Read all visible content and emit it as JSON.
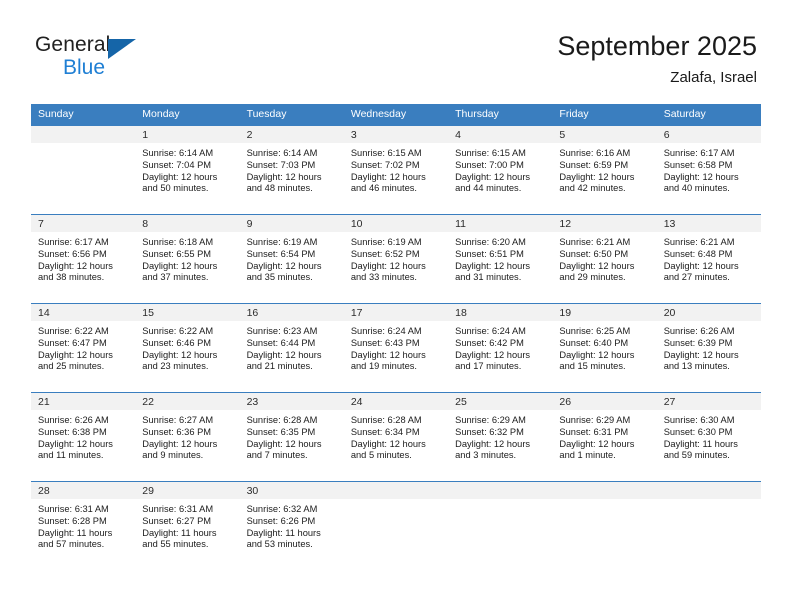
{
  "brand": {
    "name_top": "General",
    "name_bottom": "Blue",
    "accent_color": "#1f7fd4",
    "triangle_color": "#1565a8"
  },
  "header": {
    "title": "September 2025",
    "subtitle": "Zalafa, Israel"
  },
  "theme": {
    "header_row_bg": "#3a7ebf",
    "daynum_bg": "#f2f2f2",
    "grid_line": "#3a7ebf",
    "text": "#1c1c1c"
  },
  "weekdays": [
    "Sunday",
    "Monday",
    "Tuesday",
    "Wednesday",
    "Thursday",
    "Friday",
    "Saturday"
  ],
  "weeks": [
    [
      {
        "day": "",
        "sunrise": "",
        "sunset": "",
        "daylight_line1": "",
        "daylight_line2": ""
      },
      {
        "day": "1",
        "sunrise": "Sunrise: 6:14 AM",
        "sunset": "Sunset: 7:04 PM",
        "daylight_line1": "Daylight: 12 hours",
        "daylight_line2": "and 50 minutes."
      },
      {
        "day": "2",
        "sunrise": "Sunrise: 6:14 AM",
        "sunset": "Sunset: 7:03 PM",
        "daylight_line1": "Daylight: 12 hours",
        "daylight_line2": "and 48 minutes."
      },
      {
        "day": "3",
        "sunrise": "Sunrise: 6:15 AM",
        "sunset": "Sunset: 7:02 PM",
        "daylight_line1": "Daylight: 12 hours",
        "daylight_line2": "and 46 minutes."
      },
      {
        "day": "4",
        "sunrise": "Sunrise: 6:15 AM",
        "sunset": "Sunset: 7:00 PM",
        "daylight_line1": "Daylight: 12 hours",
        "daylight_line2": "and 44 minutes."
      },
      {
        "day": "5",
        "sunrise": "Sunrise: 6:16 AM",
        "sunset": "Sunset: 6:59 PM",
        "daylight_line1": "Daylight: 12 hours",
        "daylight_line2": "and 42 minutes."
      },
      {
        "day": "6",
        "sunrise": "Sunrise: 6:17 AM",
        "sunset": "Sunset: 6:58 PM",
        "daylight_line1": "Daylight: 12 hours",
        "daylight_line2": "and 40 minutes."
      }
    ],
    [
      {
        "day": "7",
        "sunrise": "Sunrise: 6:17 AM",
        "sunset": "Sunset: 6:56 PM",
        "daylight_line1": "Daylight: 12 hours",
        "daylight_line2": "and 38 minutes."
      },
      {
        "day": "8",
        "sunrise": "Sunrise: 6:18 AM",
        "sunset": "Sunset: 6:55 PM",
        "daylight_line1": "Daylight: 12 hours",
        "daylight_line2": "and 37 minutes."
      },
      {
        "day": "9",
        "sunrise": "Sunrise: 6:19 AM",
        "sunset": "Sunset: 6:54 PM",
        "daylight_line1": "Daylight: 12 hours",
        "daylight_line2": "and 35 minutes."
      },
      {
        "day": "10",
        "sunrise": "Sunrise: 6:19 AM",
        "sunset": "Sunset: 6:52 PM",
        "daylight_line1": "Daylight: 12 hours",
        "daylight_line2": "and 33 minutes."
      },
      {
        "day": "11",
        "sunrise": "Sunrise: 6:20 AM",
        "sunset": "Sunset: 6:51 PM",
        "daylight_line1": "Daylight: 12 hours",
        "daylight_line2": "and 31 minutes."
      },
      {
        "day": "12",
        "sunrise": "Sunrise: 6:21 AM",
        "sunset": "Sunset: 6:50 PM",
        "daylight_line1": "Daylight: 12 hours",
        "daylight_line2": "and 29 minutes."
      },
      {
        "day": "13",
        "sunrise": "Sunrise: 6:21 AM",
        "sunset": "Sunset: 6:48 PM",
        "daylight_line1": "Daylight: 12 hours",
        "daylight_line2": "and 27 minutes."
      }
    ],
    [
      {
        "day": "14",
        "sunrise": "Sunrise: 6:22 AM",
        "sunset": "Sunset: 6:47 PM",
        "daylight_line1": "Daylight: 12 hours",
        "daylight_line2": "and 25 minutes."
      },
      {
        "day": "15",
        "sunrise": "Sunrise: 6:22 AM",
        "sunset": "Sunset: 6:46 PM",
        "daylight_line1": "Daylight: 12 hours",
        "daylight_line2": "and 23 minutes."
      },
      {
        "day": "16",
        "sunrise": "Sunrise: 6:23 AM",
        "sunset": "Sunset: 6:44 PM",
        "daylight_line1": "Daylight: 12 hours",
        "daylight_line2": "and 21 minutes."
      },
      {
        "day": "17",
        "sunrise": "Sunrise: 6:24 AM",
        "sunset": "Sunset: 6:43 PM",
        "daylight_line1": "Daylight: 12 hours",
        "daylight_line2": "and 19 minutes."
      },
      {
        "day": "18",
        "sunrise": "Sunrise: 6:24 AM",
        "sunset": "Sunset: 6:42 PM",
        "daylight_line1": "Daylight: 12 hours",
        "daylight_line2": "and 17 minutes."
      },
      {
        "day": "19",
        "sunrise": "Sunrise: 6:25 AM",
        "sunset": "Sunset: 6:40 PM",
        "daylight_line1": "Daylight: 12 hours",
        "daylight_line2": "and 15 minutes."
      },
      {
        "day": "20",
        "sunrise": "Sunrise: 6:26 AM",
        "sunset": "Sunset: 6:39 PM",
        "daylight_line1": "Daylight: 12 hours",
        "daylight_line2": "and 13 minutes."
      }
    ],
    [
      {
        "day": "21",
        "sunrise": "Sunrise: 6:26 AM",
        "sunset": "Sunset: 6:38 PM",
        "daylight_line1": "Daylight: 12 hours",
        "daylight_line2": "and 11 minutes."
      },
      {
        "day": "22",
        "sunrise": "Sunrise: 6:27 AM",
        "sunset": "Sunset: 6:36 PM",
        "daylight_line1": "Daylight: 12 hours",
        "daylight_line2": "and 9 minutes."
      },
      {
        "day": "23",
        "sunrise": "Sunrise: 6:28 AM",
        "sunset": "Sunset: 6:35 PM",
        "daylight_line1": "Daylight: 12 hours",
        "daylight_line2": "and 7 minutes."
      },
      {
        "day": "24",
        "sunrise": "Sunrise: 6:28 AM",
        "sunset": "Sunset: 6:34 PM",
        "daylight_line1": "Daylight: 12 hours",
        "daylight_line2": "and 5 minutes."
      },
      {
        "day": "25",
        "sunrise": "Sunrise: 6:29 AM",
        "sunset": "Sunset: 6:32 PM",
        "daylight_line1": "Daylight: 12 hours",
        "daylight_line2": "and 3 minutes."
      },
      {
        "day": "26",
        "sunrise": "Sunrise: 6:29 AM",
        "sunset": "Sunset: 6:31 PM",
        "daylight_line1": "Daylight: 12 hours",
        "daylight_line2": "and 1 minute."
      },
      {
        "day": "27",
        "sunrise": "Sunrise: 6:30 AM",
        "sunset": "Sunset: 6:30 PM",
        "daylight_line1": "Daylight: 11 hours",
        "daylight_line2": "and 59 minutes."
      }
    ],
    [
      {
        "day": "28",
        "sunrise": "Sunrise: 6:31 AM",
        "sunset": "Sunset: 6:28 PM",
        "daylight_line1": "Daylight: 11 hours",
        "daylight_line2": "and 57 minutes."
      },
      {
        "day": "29",
        "sunrise": "Sunrise: 6:31 AM",
        "sunset": "Sunset: 6:27 PM",
        "daylight_line1": "Daylight: 11 hours",
        "daylight_line2": "and 55 minutes."
      },
      {
        "day": "30",
        "sunrise": "Sunrise: 6:32 AM",
        "sunset": "Sunset: 6:26 PM",
        "daylight_line1": "Daylight: 11 hours",
        "daylight_line2": "and 53 minutes."
      },
      {
        "day": "",
        "sunrise": "",
        "sunset": "",
        "daylight_line1": "",
        "daylight_line2": ""
      },
      {
        "day": "",
        "sunrise": "",
        "sunset": "",
        "daylight_line1": "",
        "daylight_line2": ""
      },
      {
        "day": "",
        "sunrise": "",
        "sunset": "",
        "daylight_line1": "",
        "daylight_line2": ""
      },
      {
        "day": "",
        "sunrise": "",
        "sunset": "",
        "daylight_line1": "",
        "daylight_line2": ""
      }
    ]
  ]
}
